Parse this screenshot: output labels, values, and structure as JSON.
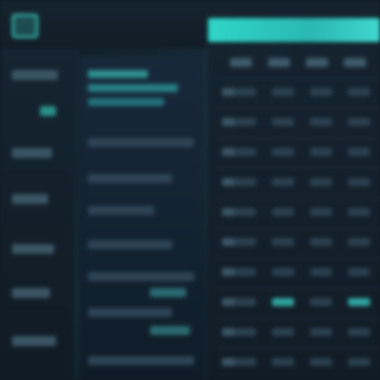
{
  "app": {
    "title": "",
    "accent_color": "#3ad0c4"
  },
  "sidebar": {
    "items": [
      {
        "label": "",
        "active": false
      },
      {
        "label": "",
        "active": true
      },
      {
        "label": "",
        "active": false
      },
      {
        "label": "",
        "active": false
      },
      {
        "label": "",
        "active": false
      },
      {
        "label": "",
        "active": false
      },
      {
        "label": "",
        "active": false
      }
    ]
  },
  "list_panel": {
    "title": "",
    "rows": [
      "",
      "",
      "",
      "",
      "",
      "",
      "",
      "",
      ""
    ]
  },
  "table": {
    "columns": [
      "",
      "",
      "",
      ""
    ],
    "rows": [
      {
        "label": "",
        "cells": [
          "",
          "",
          "",
          ""
        ]
      },
      {
        "label": "",
        "cells": [
          "",
          "",
          "",
          ""
        ]
      },
      {
        "label": "",
        "cells": [
          "",
          "",
          "",
          ""
        ]
      },
      {
        "label": "",
        "cells": [
          "",
          "",
          "",
          ""
        ]
      },
      {
        "label": "",
        "cells": [
          "",
          "",
          "",
          ""
        ]
      },
      {
        "label": "",
        "cells": [
          "",
          "",
          "",
          ""
        ]
      },
      {
        "label": "",
        "cells": [
          "",
          "",
          "",
          ""
        ]
      },
      {
        "label": "",
        "cells": [
          "",
          "",
          "",
          ""
        ]
      },
      {
        "label": "",
        "cells": [
          "",
          "",
          "",
          ""
        ]
      },
      {
        "label": "",
        "cells": [
          "",
          "",
          "",
          ""
        ]
      }
    ]
  }
}
